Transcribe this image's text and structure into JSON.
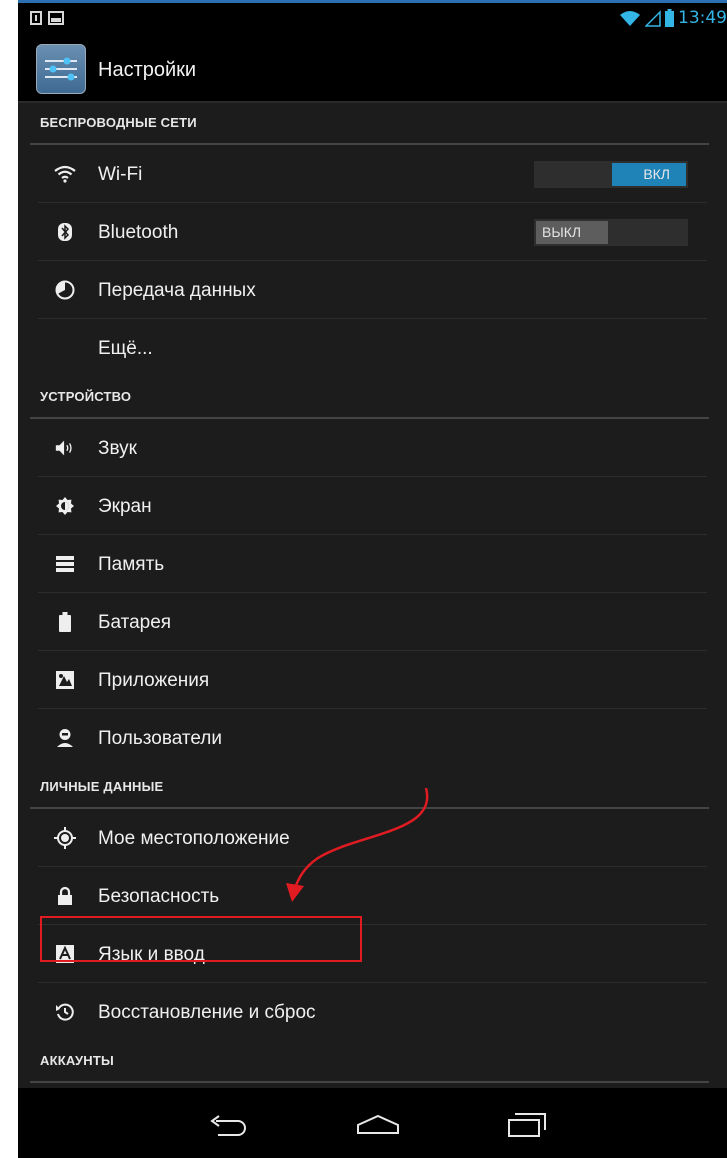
{
  "status_bar": {
    "time": "13:49"
  },
  "app": {
    "title": "Настройки"
  },
  "sections": {
    "wireless": "БЕСПРОВОДНЫЕ СЕТИ",
    "device": "УСТРОЙСТВО",
    "personal": "ЛИЧНЫЕ ДАННЫЕ",
    "accounts": "АККАУНТЫ"
  },
  "items": {
    "wifi": {
      "label": "Wi-Fi",
      "toggle": "ВКЛ",
      "on": true
    },
    "bluetooth": {
      "label": "Bluetooth",
      "toggle": "ВЫКЛ",
      "on": false
    },
    "data_usage": "Передача данных",
    "more": "Ещё...",
    "sound": "Звук",
    "display": "Экран",
    "storage": "Память",
    "battery": "Батарея",
    "apps": "Приложения",
    "users": "Пользователи",
    "location": "Мое местоположение",
    "security": "Безопасность",
    "language": "Язык и ввод",
    "backup": "Восстановление и сброс"
  },
  "colors": {
    "accent": "#33b5e5",
    "toggle_on": "#1f83b8",
    "annotation": "#e01b22"
  }
}
